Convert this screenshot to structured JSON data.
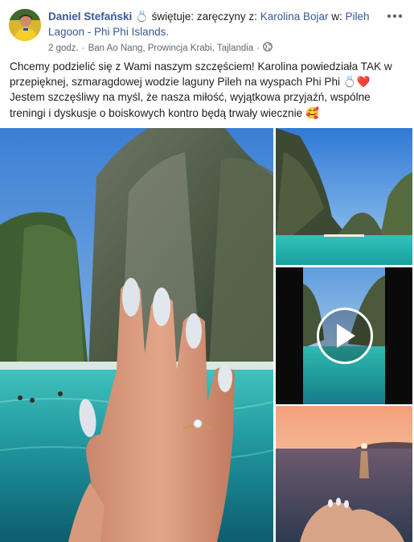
{
  "post": {
    "author": "Daniel Stefański",
    "feeling_text": "świętuje: zaręczyny z:",
    "tagged_person": "Karolina Bojar",
    "location_prefix": "w:",
    "location_name": "Pileh Lagoon - Phi Phi Islands.",
    "time": "2 godz.",
    "separator": "·",
    "place": "Ban Ao Nang, Prowincja Krabi, Tajlandia",
    "privacy_icon": "globe-icon",
    "more_options_icon": "more-options-icon",
    "text": "Chcemy podzielić się z Wami naszym szczęściem! Karolina powiedziała TAK w przepięknej, szmaragdowej wodzie laguny Pileh na wyspach Phi Phi 💍❤️ Jestem szczęśliwy na myśl, że nasza miłość, wyjątkowa przyjaźń, wspólne treningi i dyskusje o boiskowych kontro będą trwały wiecznie 🥰"
  },
  "colors": {
    "link": "#385898",
    "muted": "#606770",
    "text": "#1c1e21",
    "water": "#2bb3b0",
    "sky": "#4a90d9"
  },
  "media": {
    "play_icon": "play-icon"
  }
}
